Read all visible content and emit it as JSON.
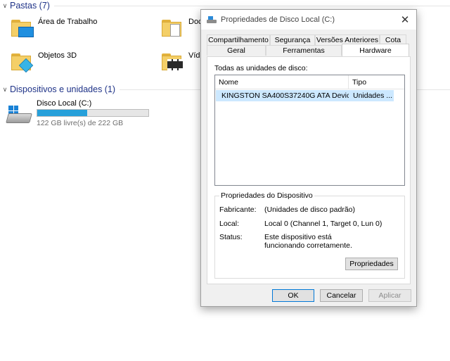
{
  "explorer": {
    "folders_header": "Pastas (7)",
    "folders": [
      {
        "label": "Área de Trabalho",
        "icon": "desktop-folder-icon"
      },
      {
        "label": "Doc",
        "icon": "documents-folder-icon"
      },
      {
        "label": "Objetos 3D",
        "icon": "3d-objects-folder-icon"
      },
      {
        "label": "Víde",
        "icon": "videos-folder-icon"
      }
    ],
    "devices_header": "Dispositivos e unidades (1)",
    "drive": {
      "name": "Disco Local (C:)",
      "free_text": "122 GB livre(s) de 222 GB",
      "used_fraction": 0.45,
      "icon": "hard-drive-icon"
    }
  },
  "dialog": {
    "title": "Propriedades de Disco Local (C:)",
    "close_glyph": "✕",
    "tabs_top": [
      "Compartilhamento",
      "Segurança",
      "Versões Anteriores",
      "Cota"
    ],
    "tabs_bottom": [
      "Geral",
      "Ferramentas",
      "Hardware"
    ],
    "active_tab": "Hardware",
    "all_disks_label": "Todas as unidades de disco:",
    "columns": [
      "Nome",
      "Tipo"
    ],
    "rows": [
      {
        "name": "KINGSTON SA400S37240G ATA Device",
        "type": "Unidades ..."
      }
    ],
    "device_props": {
      "legend": "Propriedades do Dispositivo",
      "manufacturer_label": "Fabricante:",
      "manufacturer_value": "(Unidades de disco padrão)",
      "location_label": "Local:",
      "location_value": "Local 0 (Channel 1, Target 0, Lun 0)",
      "status_label": "Status:",
      "status_value": "Este dispositivo está funcionando corretamente.",
      "properties_button": "Propriedades"
    },
    "buttons": {
      "ok": "OK",
      "cancel": "Cancelar",
      "apply": "Aplicar"
    }
  }
}
